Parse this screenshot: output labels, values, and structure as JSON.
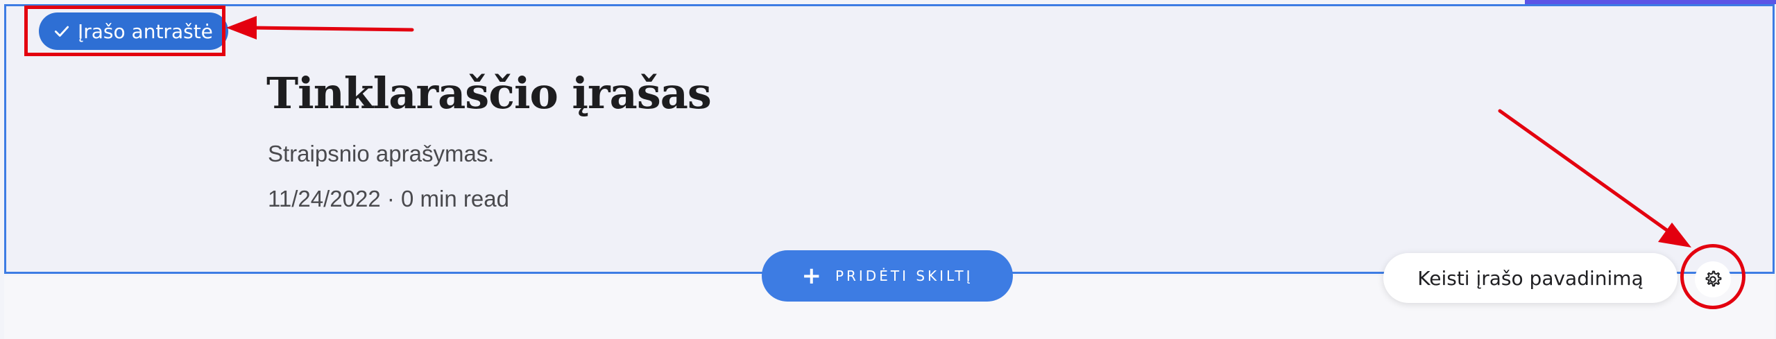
{
  "header": {
    "badge_label": "Įrašo antraštė",
    "title": "Tinklaraščio įrašas",
    "description": "Straipsnio aprašymas.",
    "meta": "11/24/2022 · 0 min read"
  },
  "actions": {
    "add_section_label": "PRIDĖTI SKILTĮ",
    "rename_label": "Keisti įrašo pavadinimą"
  },
  "colors": {
    "accent": "#3d7ce3",
    "badge": "#2e6fd4",
    "highlight": "#e3000f"
  },
  "icons": {
    "check": "check-icon",
    "plus": "plus-icon",
    "gear": "gear-icon"
  }
}
